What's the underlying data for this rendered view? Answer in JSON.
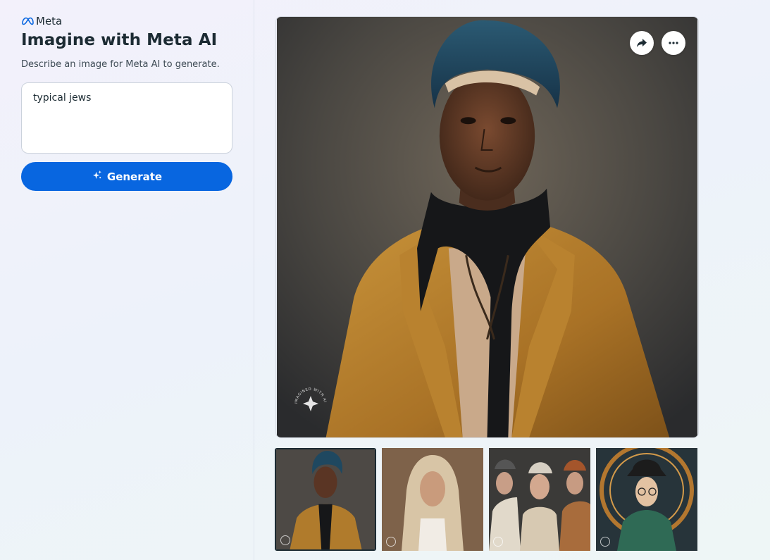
{
  "brand": {
    "name": "Meta",
    "logo_icon": "meta-infinity-logo",
    "logo_color": "#0866e0"
  },
  "header": {
    "title": "Imagine with Meta AI",
    "subtitle": "Describe an image for Meta AI to generate."
  },
  "prompt": {
    "value": "typical jews"
  },
  "generate_button": {
    "label": "Generate",
    "icon": "sparkle-icon",
    "color": "#0866e0"
  },
  "main_image": {
    "description_icon": "generated-portrait",
    "actions": [
      {
        "name": "share",
        "icon": "share-arrow-icon"
      },
      {
        "name": "more",
        "icon": "more-dots-icon"
      }
    ],
    "watermark_text": "IMAGINED WITH AI"
  },
  "thumbnails": [
    {
      "name": "thumbnail-1",
      "selected": true
    },
    {
      "name": "thumbnail-2",
      "selected": false
    },
    {
      "name": "thumbnail-3",
      "selected": false
    },
    {
      "name": "thumbnail-4",
      "selected": false
    }
  ]
}
